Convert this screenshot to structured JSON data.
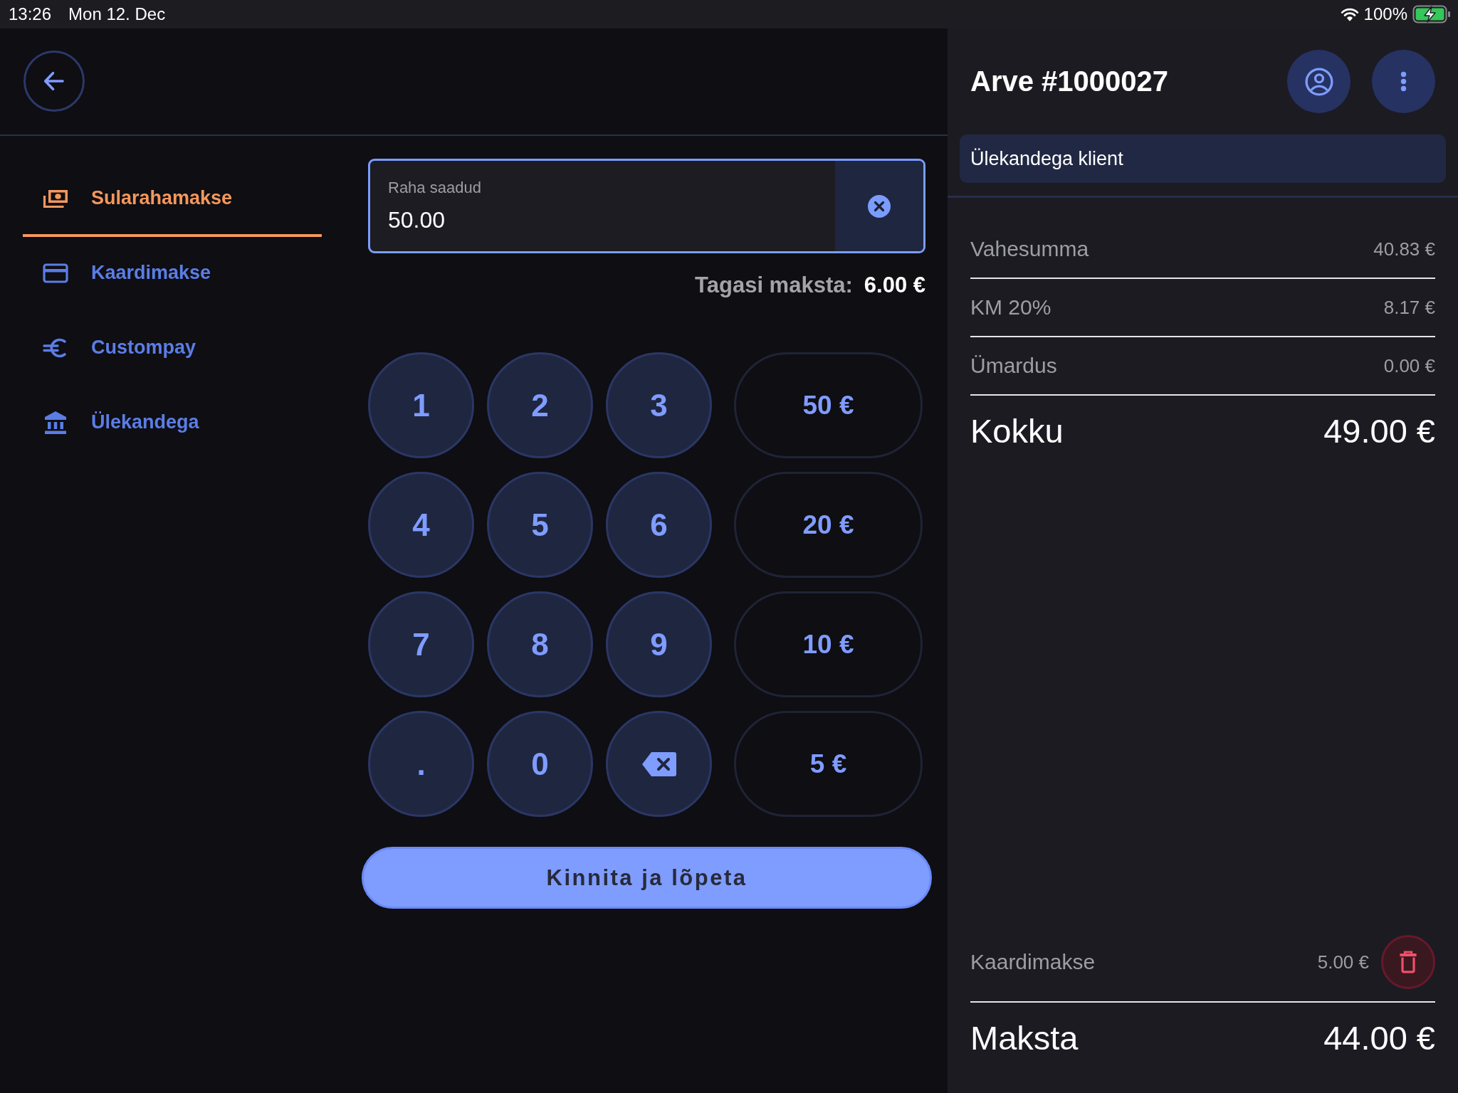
{
  "status_bar": {
    "time": "13:26",
    "date": "Mon 12. Dec",
    "battery": "100%"
  },
  "payment_methods": [
    {
      "kind": "cash",
      "label": "Sularahamakse",
      "selected": true
    },
    {
      "kind": "card",
      "label": "Kaardimakse",
      "selected": false
    },
    {
      "kind": "euro",
      "label": "Custompay",
      "selected": false
    },
    {
      "kind": "bank",
      "label": "Ülekandega",
      "selected": false
    }
  ],
  "amount_field": {
    "label": "Raha saadud",
    "value": "50.00"
  },
  "change": {
    "label": "Tagasi maksta:",
    "value": "6.00 €"
  },
  "keypad": [
    {
      "keys": [
        {
          "kind": "digit",
          "label": "1"
        },
        {
          "kind": "digit",
          "label": "2"
        },
        {
          "kind": "digit",
          "label": "3"
        }
      ],
      "quick_amount": "50 €"
    },
    {
      "keys": [
        {
          "kind": "digit",
          "label": "4"
        },
        {
          "kind": "digit",
          "label": "5"
        },
        {
          "kind": "digit",
          "label": "6"
        }
      ],
      "quick_amount": "20 €"
    },
    {
      "keys": [
        {
          "kind": "digit",
          "label": "7"
        },
        {
          "kind": "digit",
          "label": "8"
        },
        {
          "kind": "digit",
          "label": "9"
        }
      ],
      "quick_amount": "10 €"
    },
    {
      "keys": [
        {
          "kind": "digit",
          "label": "."
        },
        {
          "kind": "digit",
          "label": "0"
        },
        {
          "kind": "backspace"
        }
      ],
      "quick_amount": "5 €"
    }
  ],
  "confirm_button": "Kinnita ja lõpeta",
  "invoice": {
    "title": "Arve #1000027",
    "customer": "Ülekandega klient",
    "lines": [
      {
        "label": "Vahesumma",
        "value": "40.83 €"
      },
      {
        "label": "KM 20%",
        "value": "8.17 €"
      },
      {
        "label": "Ümardus",
        "value": "0.00 €"
      }
    ],
    "total": {
      "label": "Kokku",
      "value": "49.00 €"
    },
    "payments": [
      {
        "label": "Kaardimakse",
        "value": "5.00 €"
      }
    ],
    "due": {
      "label": "Maksta",
      "value": "44.00 €"
    }
  }
}
